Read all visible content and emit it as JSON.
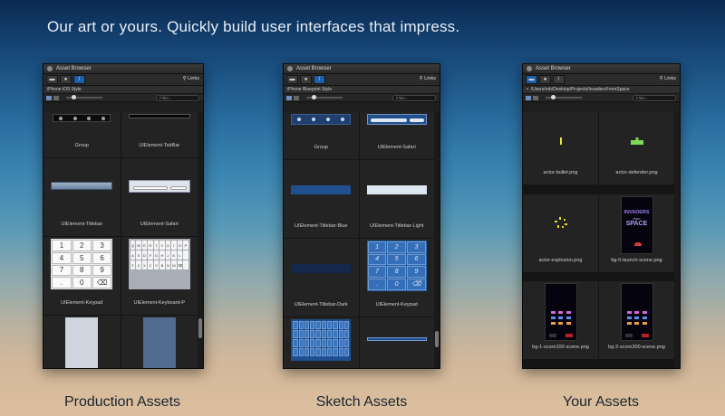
{
  "headline": "Our art or yours. Quickly build user interfaces that impress.",
  "panels": [
    {
      "title": "Asset Browser",
      "links_label": "Links",
      "path": "iPhone iOS Style",
      "filter_placeholder": "Filter...",
      "items": [
        {
          "label": "Group",
          "kind": "tabbar-prev"
        },
        {
          "label": "UIElement-TabBar",
          "kind": "tabbar-black"
        },
        {
          "label": "UIElement-Titlebar",
          "kind": "titlebar-prev"
        },
        {
          "label": "UIElement-Safari",
          "kind": "safari-prev"
        },
        {
          "label": "UIElement-Keypad",
          "kind": "keypad-prev"
        },
        {
          "label": "UIElement-Keyboard-P",
          "kind": "keyboard-prev"
        },
        {
          "label": "",
          "kind": "phone-light"
        },
        {
          "label": "",
          "kind": "phone-dark"
        }
      ],
      "keypad_keys": [
        "1",
        "2",
        "3",
        "4",
        "5",
        "6",
        "7",
        "8",
        "9",
        ".",
        "0",
        "⌫"
      ],
      "keyboard_keys": [
        "Q",
        "W",
        "E",
        "R",
        "T",
        "Y",
        "U",
        "I",
        "O",
        "P",
        "A",
        "S",
        "D",
        "F",
        "G",
        "H",
        "J",
        "K",
        "L",
        "",
        "⇧",
        "Z",
        "X",
        "C",
        "V",
        "B",
        "N",
        "M",
        "⌫",
        ""
      ]
    },
    {
      "title": "Asset Browser",
      "links_label": "Links",
      "path": "iPhone Blueprint Style",
      "filter_placeholder": "Filter...",
      "items": [
        {
          "label": "Group",
          "kind": "bp-tabbar"
        },
        {
          "label": "UIElement-Safari",
          "kind": "bp-safari"
        },
        {
          "label": "UIElement-Titlebar-Blue",
          "kind": "bp-title-blue"
        },
        {
          "label": "UIElement-Titlebar-Light",
          "kind": "bp-title-light"
        },
        {
          "label": "UIElement-Titlebar-Dark",
          "kind": "bp-title-dark"
        },
        {
          "label": "UIElement-Keypad",
          "kind": "bp-keypad"
        },
        {
          "label": "",
          "kind": "bp-keyboard"
        },
        {
          "label": "",
          "kind": "bp-thin"
        }
      ],
      "keypad_keys": [
        "1",
        "2",
        "3",
        "4",
        "5",
        "6",
        "7",
        "8",
        "9",
        ".",
        "0",
        "⌫"
      ]
    },
    {
      "title": "Asset Browser",
      "links_label": "Links",
      "path": "/Users/rob/Desktop/Projects/InvadersFromSpace",
      "filter_placeholder": "Filter...",
      "items": [
        {
          "label": "actor-bullet.png",
          "kind": "bullet"
        },
        {
          "label": "actor-defender.png",
          "kind": "defender"
        },
        {
          "label": "actor-explosion.png",
          "kind": "explosion"
        },
        {
          "label": "bg-0-launch-scene.png",
          "kind": "invaders-art"
        },
        {
          "label": "bg-1-score100-scene.png",
          "kind": "game-art"
        },
        {
          "label": "bg-2-score200-scene.png",
          "kind": "game-art"
        }
      ],
      "invaders_title": {
        "line1": "INVADERS",
        "line2": "from",
        "line3": "SPACE"
      }
    }
  ],
  "captions": [
    "Production Assets",
    "Sketch Assets",
    "Your Assets"
  ],
  "colors": {
    "accent": "#1d5fa8",
    "bullet": "#e8e23a",
    "defender": "#7ed957",
    "explosion": "#e8d82a",
    "invader_purple": "#9b7ee6",
    "invader_red": "#d43d3d"
  }
}
